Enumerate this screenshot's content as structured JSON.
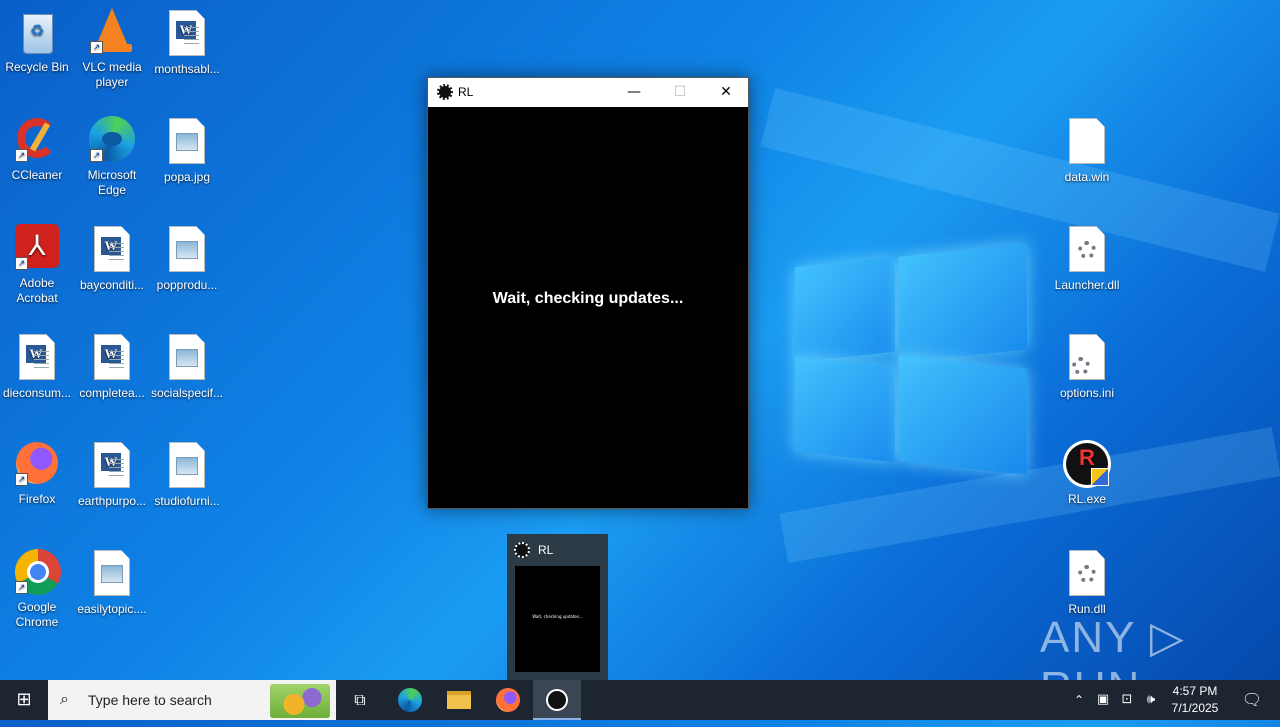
{
  "desktop": {
    "icons": [
      {
        "label": "Recycle Bin"
      },
      {
        "label": "VLC media player"
      },
      {
        "label": "monthsabl..."
      },
      {
        "label": "CCleaner"
      },
      {
        "label": "Microsoft Edge"
      },
      {
        "label": "popa.jpg"
      },
      {
        "label": "Adobe Acrobat"
      },
      {
        "label": "bayconditi..."
      },
      {
        "label": "popprodu..."
      },
      {
        "label": "dieconsum..."
      },
      {
        "label": "completea..."
      },
      {
        "label": "socialspecif..."
      },
      {
        "label": "Firefox"
      },
      {
        "label": "earthpurpo..."
      },
      {
        "label": "studiofurni..."
      },
      {
        "label": "Google Chrome"
      },
      {
        "label": "easilytopic...."
      },
      {
        "label": "data.win"
      },
      {
        "label": "Launcher.dll"
      },
      {
        "label": "options.ini"
      },
      {
        "label": "RL.exe"
      },
      {
        "label": "Run.dll"
      }
    ]
  },
  "window": {
    "title": "RL",
    "message": "Wait, checking updates...",
    "minimize_glyph": "—",
    "maximize_glyph": "☐",
    "close_glyph": "✕"
  },
  "preview": {
    "title": "RL",
    "message": "Wait, checking updates..."
  },
  "watermark": "ANY ▷ RUN",
  "taskbar": {
    "search_placeholder": "Type here to search",
    "time": "4:57 PM",
    "date": "7/1/2025"
  }
}
